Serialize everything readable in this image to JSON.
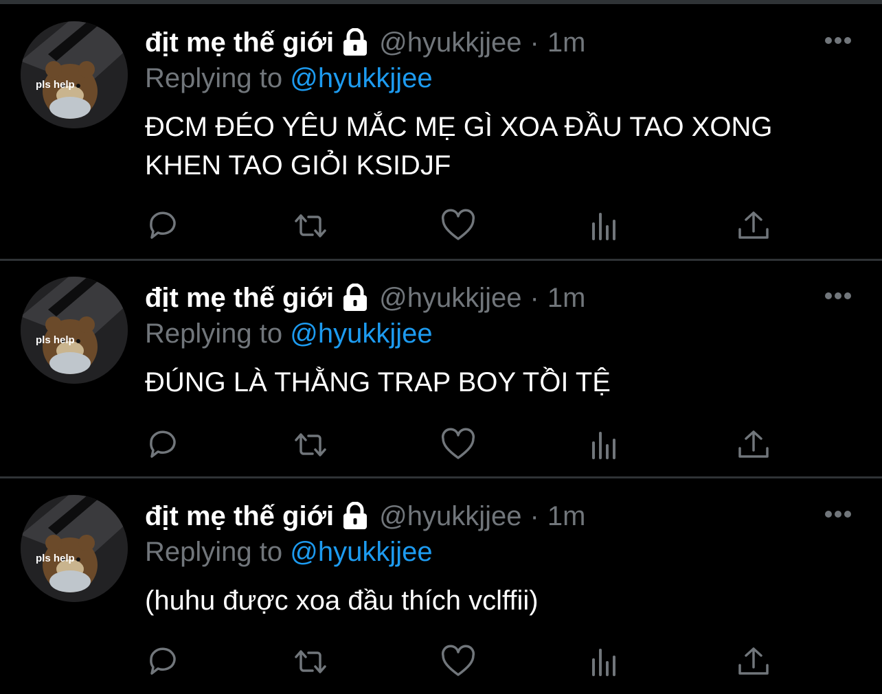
{
  "tweets": [
    {
      "display_name": "địt mẹ thế giới",
      "handle": "@hyukkjjee",
      "separator": "·",
      "time": "1m",
      "replying_prefix": "Replying to",
      "replying_to": "@hyukkjjee",
      "text": "ĐCM ĐÉO YÊU MẮC MẸ GÌ XOA ĐẦU TAO XONG\nKHEN TAO GIỎI KSIDJF",
      "avatar_caption": "pls help"
    },
    {
      "display_name": "địt mẹ thế giới",
      "handle": "@hyukkjjee",
      "separator": "·",
      "time": "1m",
      "replying_prefix": "Replying to",
      "replying_to": "@hyukkjjee",
      "text": "ĐÚNG LÀ THẰNG TRAP BOY TỒI TỆ",
      "avatar_caption": "pls help"
    },
    {
      "display_name": "địt mẹ thế giới",
      "handle": "@hyukkjjee",
      "separator": "·",
      "time": "1m",
      "replying_prefix": "Replying to",
      "replying_to": "@hyukkjjee",
      "text": "(huhu được xoa đầu thích vclffii)",
      "avatar_caption": "pls help"
    }
  ],
  "icons": {
    "lock": "lock-icon",
    "more": "more-icon",
    "reply": "reply-icon",
    "retweet": "retweet-icon",
    "like": "like-icon",
    "analytics": "analytics-icon",
    "share": "share-icon"
  },
  "colors": {
    "background": "#000000",
    "text": "#ffffff",
    "muted": "#71767b",
    "link": "#1d9bf0",
    "divider": "#2f3336"
  }
}
